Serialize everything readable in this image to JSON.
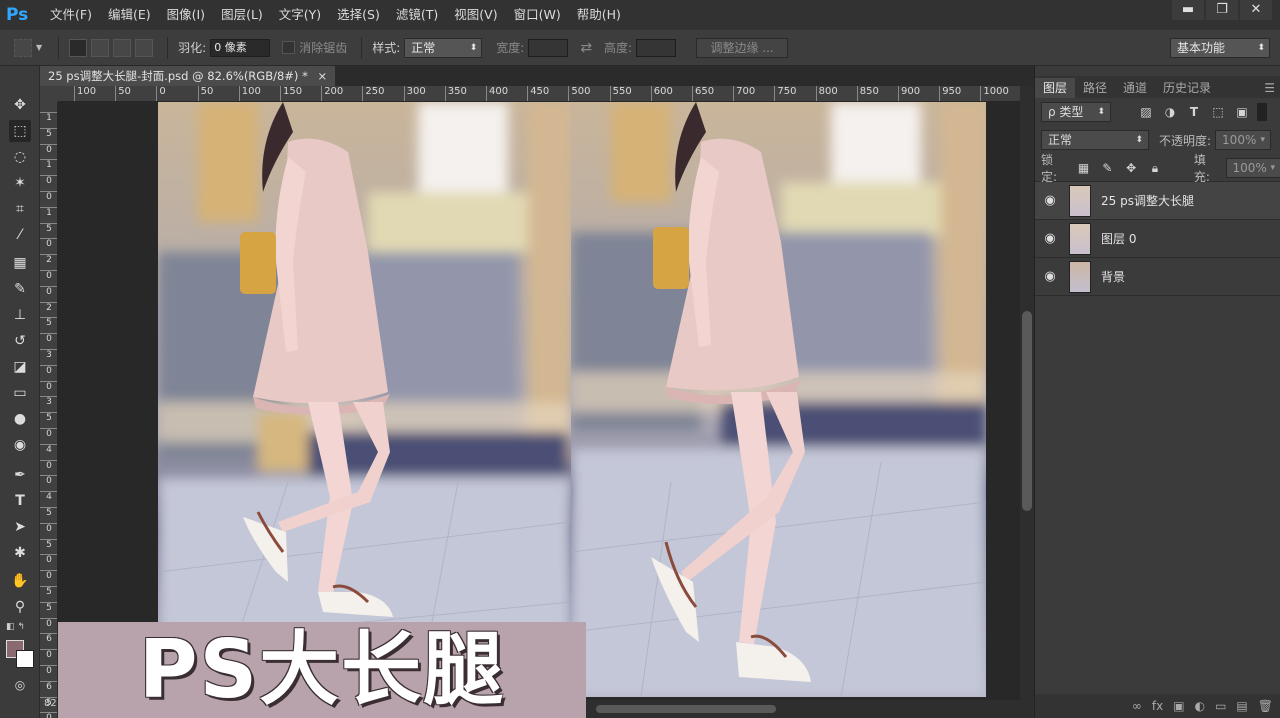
{
  "app": {
    "logo": "Ps"
  },
  "menu": [
    "文件(F)",
    "编辑(E)",
    "图像(I)",
    "图层(L)",
    "文字(Y)",
    "选择(S)",
    "滤镜(T)",
    "视图(V)",
    "窗口(W)",
    "帮助(H)"
  ],
  "window_controls": {
    "minimize": "▬",
    "restore": "❐",
    "close": "✕"
  },
  "options": {
    "feather_label": "羽化:",
    "feather_value": "0 像素",
    "antialias_label": "消除锯齿",
    "style_label": "样式:",
    "style_value": "正常",
    "width_label": "宽度:",
    "swap_icon": "⇄",
    "height_label": "高度:",
    "refine_button": "调整边缘 ...",
    "workspace": "基本功能"
  },
  "document_tab": {
    "title": "25 ps调整大长腿-封面.psd @ 82.6%(RGB/8#) *",
    "close": "×"
  },
  "rulers": {
    "top": [
      "100",
      "50",
      "0",
      "50",
      "100",
      "150",
      "200",
      "250",
      "300",
      "350",
      "400",
      "450",
      "500",
      "550",
      "600",
      "650",
      "700",
      "750",
      "800",
      "850",
      "900",
      "950",
      "1000"
    ],
    "left": [
      "1",
      "5",
      "0",
      "1",
      "0",
      "0",
      "1",
      "5",
      "0",
      "2",
      "0",
      "0",
      "2",
      "5",
      "0",
      "3",
      "0",
      "0",
      "3",
      "5",
      "0",
      "4",
      "0",
      "0",
      "4",
      "5",
      "0",
      "5",
      "0",
      "0",
      "5",
      "5",
      "0",
      "6",
      "0",
      "0",
      "6",
      "5",
      "0"
    ]
  },
  "panel": {
    "tabs": [
      "图层",
      "路径",
      "通道",
      "历史记录"
    ],
    "active_tab": "图层",
    "menu_icon": "☰",
    "filter_kind": "ρ 类型",
    "blend_mode": "正常",
    "opacity_label": "不透明度:",
    "opacity_value": "100%",
    "lock_label": "锁定:",
    "fill_label": "填充:",
    "fill_value": "100%",
    "layers": [
      {
        "name": "25 ps调整大长腿",
        "selected": true
      },
      {
        "name": "图层 0",
        "selected": false
      },
      {
        "name": "背景",
        "selected": false
      }
    ],
    "footer_icons": [
      "∞",
      "fx",
      "▣",
      "◐",
      "▭",
      "▤",
      "🗑"
    ]
  },
  "banner": {
    "text": "PS大长腿"
  },
  "status": {
    "zoom": "82"
  }
}
